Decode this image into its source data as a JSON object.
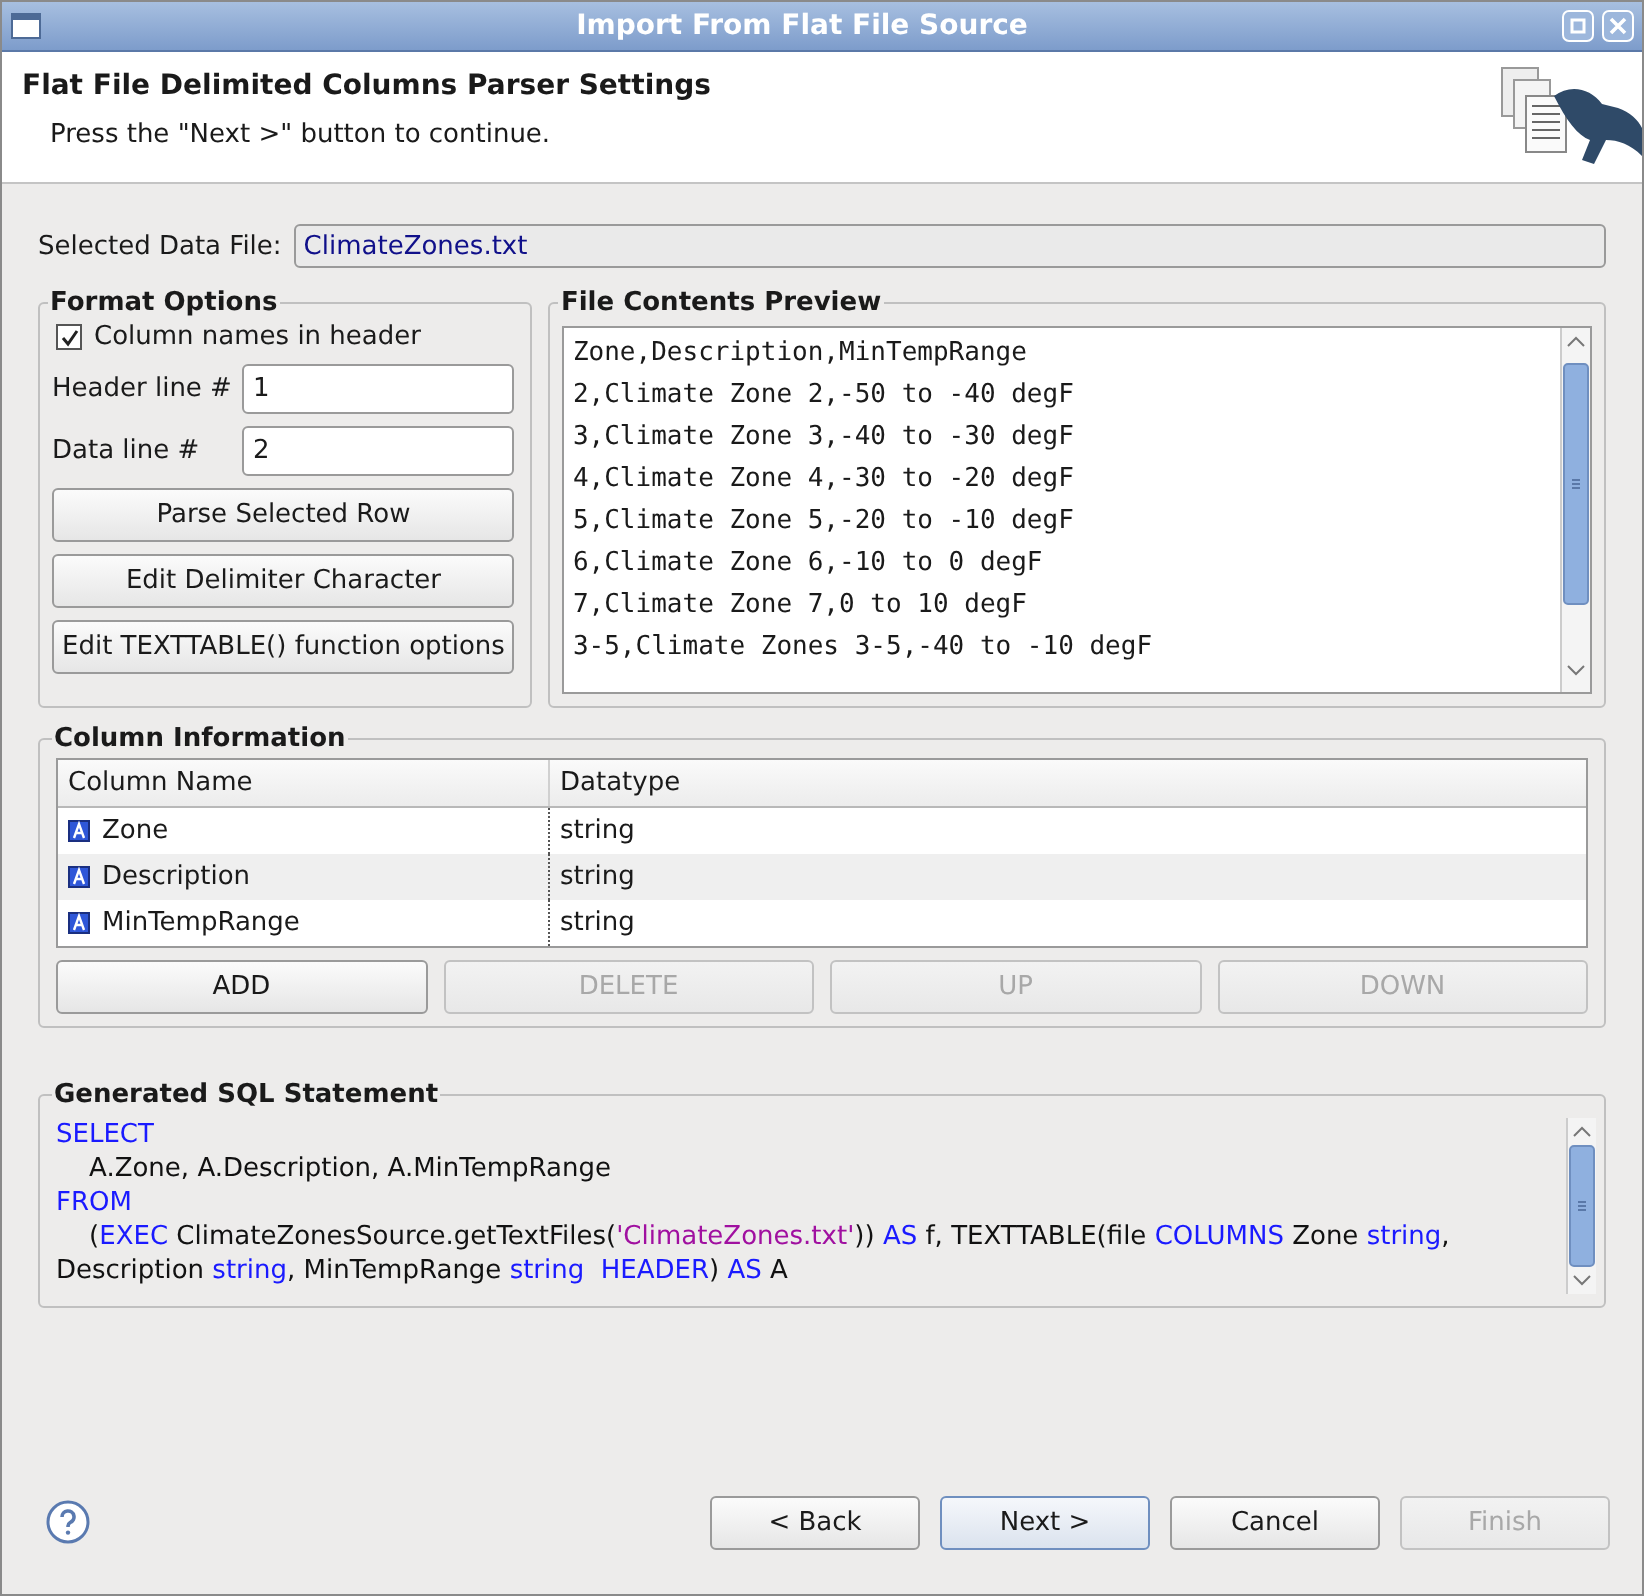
{
  "window": {
    "title": "Import From Flat File Source"
  },
  "header": {
    "title": "Flat File Delimited Columns Parser Settings",
    "message": "Press the \"Next >\" button to continue."
  },
  "data_file": {
    "label": "Selected Data File:",
    "value": "ClimateZones.txt"
  },
  "format_options": {
    "title": "Format Options",
    "checkbox": {
      "label": "Column names in header",
      "checked": true
    },
    "fields": [
      {
        "label": "Header line #",
        "value": "1"
      },
      {
        "label": "Data line #",
        "value": "2"
      }
    ],
    "buttons": [
      "Parse Selected Row",
      "Edit Delimiter Character",
      "Edit TEXTTABLE() function options"
    ]
  },
  "preview": {
    "title": "File Contents Preview",
    "lines": [
      "Zone,Description,MinTempRange",
      "2,Climate Zone 2,-50 to -40 degF",
      "3,Climate Zone 3,-40 to -30 degF",
      "4,Climate Zone 4,-30 to -20 degF",
      "5,Climate Zone 5,-20 to -10 degF",
      "6,Climate Zone 6,-10 to 0 degF",
      "7,Climate Zone 7,0 to 10 degF",
      "3-5,Climate Zones 3-5,-40 to -10 degF"
    ]
  },
  "column_info": {
    "title": "Column Information",
    "columns": [
      "Column Name",
      "Datatype"
    ],
    "rows": [
      {
        "name": "Zone",
        "datatype": "string"
      },
      {
        "name": "Description",
        "datatype": "string"
      },
      {
        "name": "MinTempRange",
        "datatype": "string"
      }
    ],
    "buttons": [
      {
        "label": "ADD",
        "disabled": false
      },
      {
        "label": "DELETE",
        "disabled": true
      },
      {
        "label": "UP",
        "disabled": true
      },
      {
        "label": "DOWN",
        "disabled": true
      }
    ]
  },
  "sql": {
    "title": "Generated SQL Statement",
    "lines": [
      [
        {
          "kind": "keyword",
          "text": "SELECT"
        }
      ],
      [
        {
          "kind": "plain",
          "text": "    A.Zone, A.Description, A.MinTempRange"
        }
      ],
      [
        {
          "kind": "keyword",
          "text": "FROM"
        }
      ],
      [
        {
          "kind": "plain",
          "text": "    ("
        },
        {
          "kind": "keyword",
          "text": "EXEC"
        },
        {
          "kind": "plain",
          "text": " ClimateZonesSource.getTextFiles("
        },
        {
          "kind": "string",
          "text": "'ClimateZones.txt'"
        },
        {
          "kind": "plain",
          "text": ")) "
        },
        {
          "kind": "keyword",
          "text": "AS"
        },
        {
          "kind": "plain",
          "text": " f, TEXTTABLE(file "
        },
        {
          "kind": "keyword",
          "text": "COLUMNS"
        },
        {
          "kind": "plain",
          "text": " Zone "
        },
        {
          "kind": "keyword",
          "text": "string"
        },
        {
          "kind": "plain",
          "text": ","
        }
      ],
      [
        {
          "kind": "plain",
          "text": "Description "
        },
        {
          "kind": "keyword",
          "text": "string"
        },
        {
          "kind": "plain",
          "text": ", MinTempRange "
        },
        {
          "kind": "keyword",
          "text": "string"
        },
        {
          "kind": "keyword",
          "text": "  HEADER"
        },
        {
          "kind": "plain",
          "text": ") "
        },
        {
          "kind": "keyword",
          "text": "AS"
        },
        {
          "kind": "plain",
          "text": " A"
        }
      ]
    ]
  },
  "footer_buttons": [
    {
      "label": "< Back",
      "disabled": false,
      "default": false
    },
    {
      "label": "Next >",
      "disabled": false,
      "default": true
    },
    {
      "label": "Cancel",
      "disabled": false,
      "default": false
    },
    {
      "label": "Finish",
      "disabled": true,
      "default": false
    }
  ]
}
